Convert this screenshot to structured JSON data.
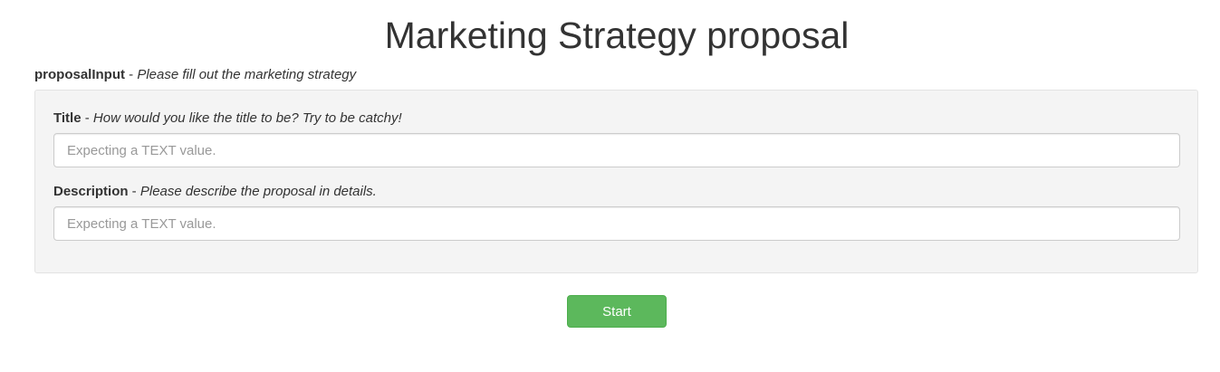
{
  "page": {
    "title": "Marketing Strategy proposal"
  },
  "section": {
    "name": "proposalInput",
    "separator": " - ",
    "description": "Please fill out the marketing strategy"
  },
  "fields": [
    {
      "name": "Title",
      "separator": " - ",
      "description": "How would you like the title to be? Try to be catchy!",
      "placeholder": "Expecting a TEXT value.",
      "value": ""
    },
    {
      "name": "Description",
      "separator": " - ",
      "description": "Please describe the proposal in details.",
      "placeholder": "Expecting a TEXT value.",
      "value": ""
    }
  ],
  "actions": {
    "start_label": "Start"
  },
  "colors": {
    "primary_button": "#5cb85c",
    "panel_background": "#f4f4f4",
    "text": "#333333"
  }
}
